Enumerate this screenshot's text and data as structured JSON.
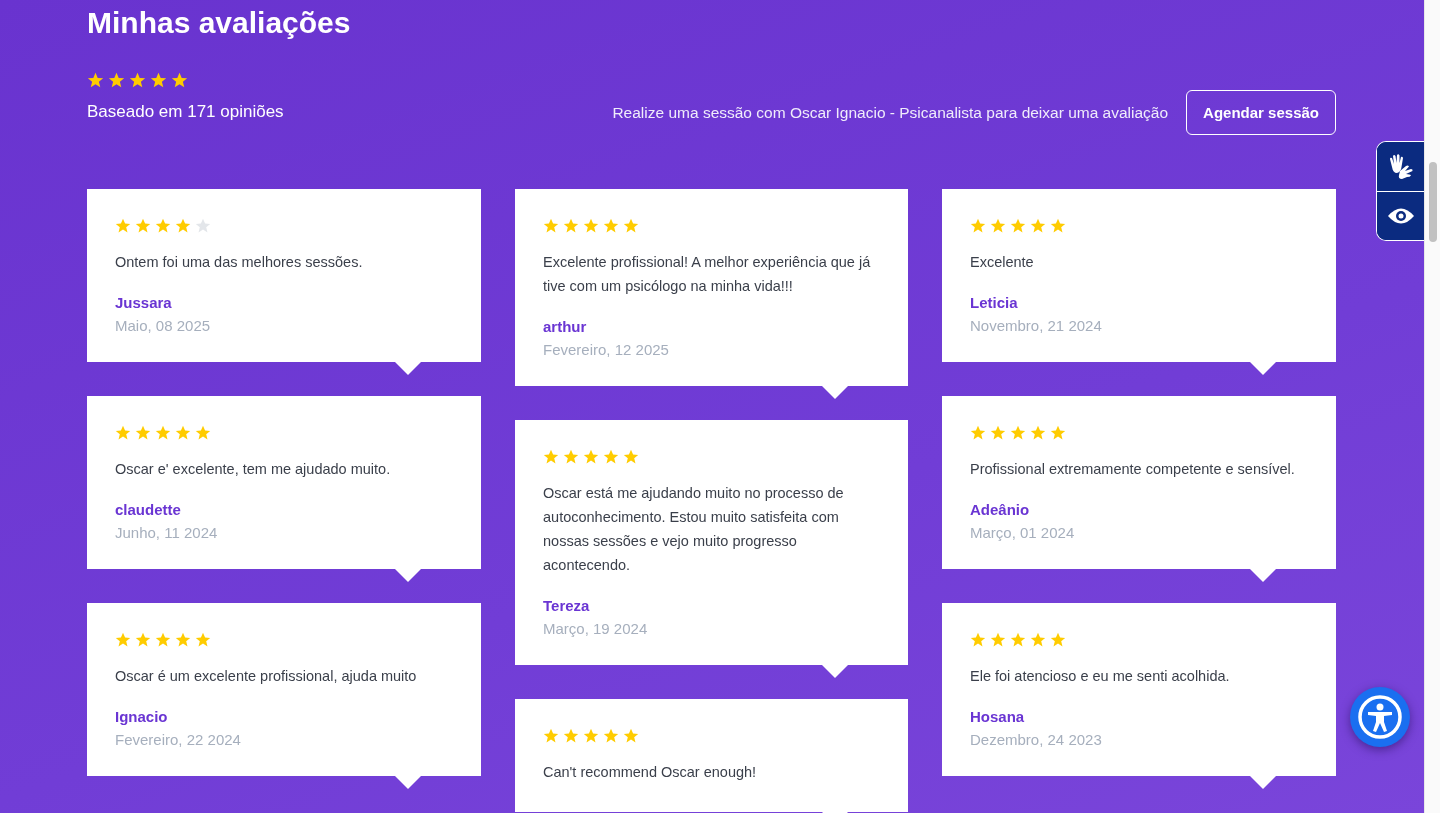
{
  "header": {
    "title": "Minhas avaliações",
    "stars": 5,
    "summary": "Baseado em 171 opiniões",
    "cta_text": "Realize uma sessão com Oscar Ignacio - Psicanalista para deixar uma avaliação",
    "cta_button": "Agendar sessão"
  },
  "columns": [
    {
      "reviews": [
        {
          "stars": 4,
          "text": "Ontem foi uma das melhores sessões.",
          "author": "Jussara",
          "date": "Maio, 08 2025"
        },
        {
          "stars": 5,
          "text": "Oscar e' excelente, tem me ajudado muito.",
          "author": "claudette",
          "date": "Junho, 11 2024"
        },
        {
          "stars": 5,
          "text": "Oscar é um excelente profissional, ajuda muito",
          "author": "Ignacio",
          "date": "Fevereiro, 22 2024"
        }
      ]
    },
    {
      "reviews": [
        {
          "stars": 5,
          "text": "Excelente profissional! A melhor experiência que já tive com um psicólogo na minha vida!!!",
          "author": "arthur",
          "date": "Fevereiro, 12 2025"
        },
        {
          "stars": 5,
          "text": "Oscar está me ajudando muito no processo de autoconhecimento. Estou muito satisfeita com nossas sessões e vejo muito progresso acontecendo.",
          "author": "Tereza",
          "date": "Março, 19 2024"
        },
        {
          "stars": 5,
          "text": "Can't recommend Oscar enough!"
        }
      ]
    },
    {
      "reviews": [
        {
          "stars": 5,
          "text": "Excelente",
          "author": "Leticia",
          "date": "Novembro, 21 2024"
        },
        {
          "stars": 5,
          "text": "Profissional extremamente competente e sensível.",
          "author": "Adeânio",
          "date": "Março, 01 2024"
        },
        {
          "stars": 5,
          "text": "Ele foi atencioso e eu me senti acolhida.",
          "author": "Hosana",
          "date": "Dezembro, 24 2023"
        }
      ]
    }
  ]
}
